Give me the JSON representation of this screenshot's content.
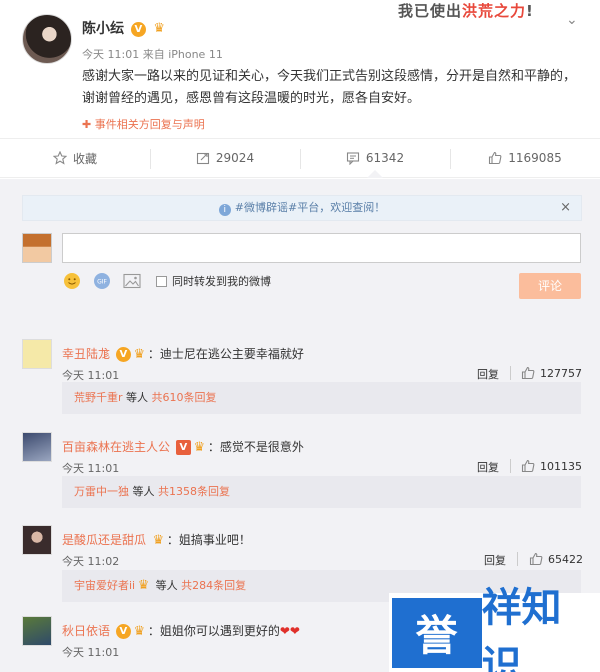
{
  "post": {
    "author": "陈小纭",
    "vbadge": "V",
    "meta": "今天 11:01 来自 iPhone 11",
    "content": "感谢大家一路以来的见证和关心，今天我们正式告别这段感情，分开是自然和平静的，谢谢曾经的遇见，感恩曾有这段温暖的时光，愿各自安好。",
    "event_link": "✚ 事件相关方回复与声明",
    "banner_a": "我已使出",
    "banner_b": "洪荒之力",
    "banner_c": "!"
  },
  "actions": [
    {
      "label": "收藏",
      "icon": "star-icon"
    },
    {
      "label": "29024",
      "icon": "share-icon"
    },
    {
      "label": "61342",
      "icon": "comment-icon"
    },
    {
      "label": "1169085",
      "icon": "thumb-up-icon"
    }
  ],
  "notice": {
    "text": "#微博辟谣#平台，欢迎查阅！",
    "close": "×"
  },
  "composer": {
    "forward_label": "同时转发到我的微博",
    "submit_label": "评论"
  },
  "comments": [
    {
      "user": "幸丑陆尨",
      "text": "：迪士尼在逃公主要幸福就好",
      "time": "今天 11:01",
      "reply": "回复",
      "likes": "127757",
      "sub_user": "荒野千重r",
      "sub_mid": " 等人 ",
      "sub_count": "共610条回复"
    },
    {
      "user": "百亩森林在逃主人公",
      "text": "：感觉不是很意外",
      "time": "今天 11:01",
      "reply": "回复",
      "likes": "101135",
      "sub_user": "万雷中一独",
      "sub_mid": " 等人 ",
      "sub_count": "共1358条回复"
    },
    {
      "user": "是酸瓜还是甜瓜",
      "text": "：姐搞事业吧！",
      "time": "今天 11:02",
      "reply": "回复",
      "likes": "65422",
      "sub_user": "宇宙爱好者ii",
      "sub_mid": " 等人 ",
      "sub_count": "共284条回复"
    },
    {
      "user": "秋日依语",
      "text": "：姐姐你可以遇到更好的",
      "hearts": "❤❤",
      "time": "今天 11:01"
    }
  ],
  "watermark": {
    "left": "誉",
    "right": "祥知识"
  },
  "colors": {
    "accent": "#eb7350",
    "submit": "#fbbd9c",
    "page_bg": "#f2f2f5",
    "watermark": "#1f6fd0"
  }
}
